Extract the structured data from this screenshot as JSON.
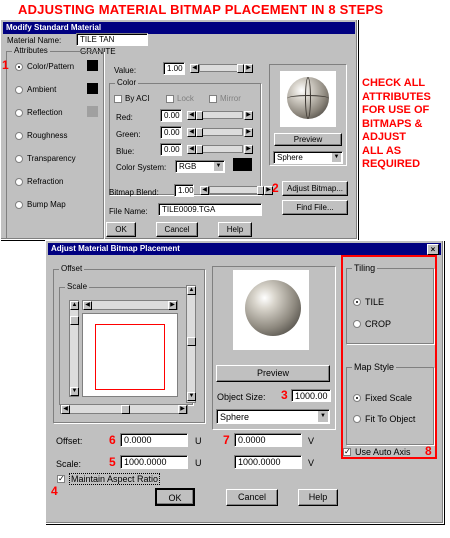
{
  "heading": "ADJUSTING MATERIAL BITMAP PLACEMENT IN 8 STEPS",
  "side_note": [
    "CHECK ALL",
    "ATTRIBUTES",
    "FOR USE OF",
    "BITMAPS &",
    "ADJUST",
    "ALL AS",
    "REQUIRED"
  ],
  "modify": {
    "title": "Modify Standard Material",
    "material_name_label": "Material Name:",
    "material_name_value": "TILE TAN GRANITE",
    "attributes_label": "Attributes",
    "attributes": [
      "Color/Pattern",
      "Ambient",
      "Reflection",
      "Roughness",
      "Transparency",
      "Refraction",
      "Bump Map"
    ],
    "value_label": "Value:",
    "value": "1.00",
    "color_label": "Color",
    "by_aci": "By ACI",
    "lock": "Lock",
    "mirror": "Mirror",
    "red_label": "Red:",
    "red_value": "0.00",
    "green_label": "Green:",
    "green_value": "0.00",
    "blue_label": "Blue:",
    "blue_value": "0.00",
    "color_system_label": "Color System:",
    "color_system_value": "RGB",
    "preview": "Preview",
    "preview_shape": "Sphere",
    "bitmap_blend_label": "Bitmap Blend:",
    "bitmap_blend_value": "1.00",
    "adjust_bitmap": "Adjust Bitmap...",
    "file_name_label": "File Name:",
    "file_name_value": "TILE0009.TGA",
    "find_file": "Find File...",
    "ok": "OK",
    "cancel": "Cancel",
    "help": "Help"
  },
  "adjust": {
    "title": "Adjust Material Bitmap Placement",
    "offset_label": "Offset",
    "scale_label": "Scale",
    "preview": "Preview",
    "object_size_label": "Object Size:",
    "object_size_value": "1000.00",
    "shape": "Sphere",
    "tiling_label": "Tiling",
    "tile": "TILE",
    "crop": "CROP",
    "map_style_label": "Map Style",
    "fixed_scale": "Fixed Scale",
    "fit_to_object": "Fit To Object",
    "use_auto_axis": "Use Auto Axis",
    "offset_row_label": "Offset:",
    "offset_u": "0.0000",
    "offset_v": "0.0000",
    "scale_row_label": "Scale:",
    "scale_u": "1000.0000",
    "scale_v": "1000.0000",
    "u": "U",
    "v": "V",
    "maintain_aspect": "Maintain Aspect Ratio",
    "ok": "OK",
    "cancel": "Cancel",
    "help": "Help"
  },
  "steps": [
    "1",
    "2",
    "3",
    "4",
    "5",
    "6",
    "7",
    "8"
  ],
  "colors": {
    "annotation": "#ff0000",
    "titlebar": "#000080",
    "dialog": "#c0c0c0"
  }
}
